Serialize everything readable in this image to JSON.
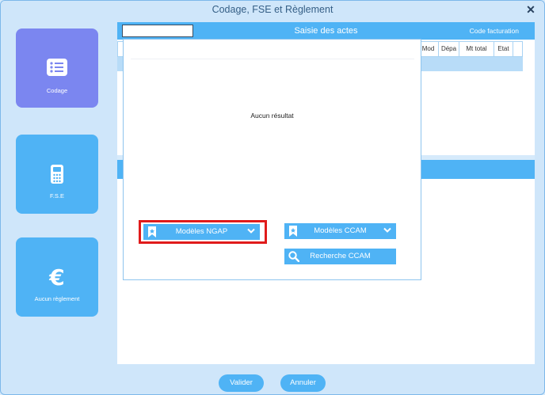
{
  "window": {
    "title": "Codage, FSE et Règlement",
    "close_icon": "close-icon"
  },
  "sidebar": {
    "items": [
      {
        "label": "Codage",
        "icon": "list-icon",
        "active": true
      },
      {
        "label": "F.S.E",
        "icon": "card-reader-icon",
        "active": false
      },
      {
        "label": "Aucun règlement",
        "icon": "euro-icon",
        "active": false
      }
    ]
  },
  "acts_panel": {
    "title": "Saisie des actes",
    "code_facturation_label": "Code facturation",
    "search_value": "",
    "columns": [
      "Mod",
      "Dépa",
      "Mt total",
      "Etat"
    ]
  },
  "popup": {
    "empty_text": "Aucun résultat",
    "models_ngap_label": "Modèles NGAP",
    "models_ccam_label": "Modèles CCAM",
    "search_ccam_label": "Recherche CCAM"
  },
  "footer": {
    "validate_label": "Valider",
    "cancel_label": "Annuler"
  },
  "colors": {
    "accent": "#4fb3f5",
    "active_tile": "#7b86f0",
    "highlight_border": "#e01b1b",
    "window_bg": "#cfe6fa"
  }
}
